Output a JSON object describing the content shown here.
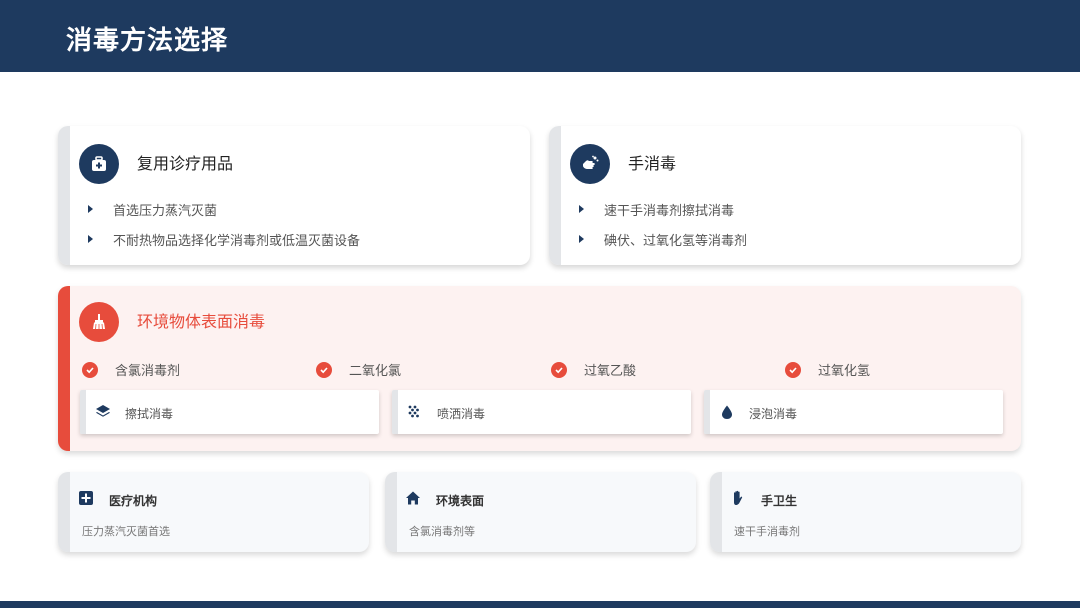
{
  "header": {
    "title": "消毒方法选择"
  },
  "cards": {
    "reuse": {
      "title": "复用诊疗用品",
      "icon": "medical-kit-icon",
      "bullets": [
        "首选压力蒸汽灭菌",
        "不耐热物品选择化学消毒剂或低温灭菌设备"
      ]
    },
    "hand": {
      "title": "手消毒",
      "icon": "hand-wash-icon",
      "bullets": [
        "速干手消毒剂擦拭消毒",
        "碘伏、过氧化氢等消毒剂"
      ]
    }
  },
  "environment": {
    "title": "环境物体表面消毒",
    "icon": "broom-icon",
    "disinfectants": [
      "含氯消毒剂",
      "二氧化氯",
      "过氧乙酸",
      "过氧化氢"
    ],
    "methods": [
      {
        "label": "擦拭消毒",
        "icon": "layers-icon"
      },
      {
        "label": "喷洒消毒",
        "icon": "spray-icon"
      },
      {
        "label": "浸泡消毒",
        "icon": "droplet-icon"
      }
    ]
  },
  "summary": [
    {
      "title": "医疗机构",
      "desc": "压力蒸汽灭菌首选",
      "icon": "hospital-cross-icon"
    },
    {
      "title": "环境表面",
      "desc": "含氯消毒剂等",
      "icon": "home-icon"
    },
    {
      "title": "手卫生",
      "desc": "速干手消毒剂",
      "icon": "hand-icon"
    }
  ],
  "colors": {
    "navy": "#1e3a5f",
    "accent_red": "#e74c3c",
    "red_bg": "#fdf2f1"
  }
}
